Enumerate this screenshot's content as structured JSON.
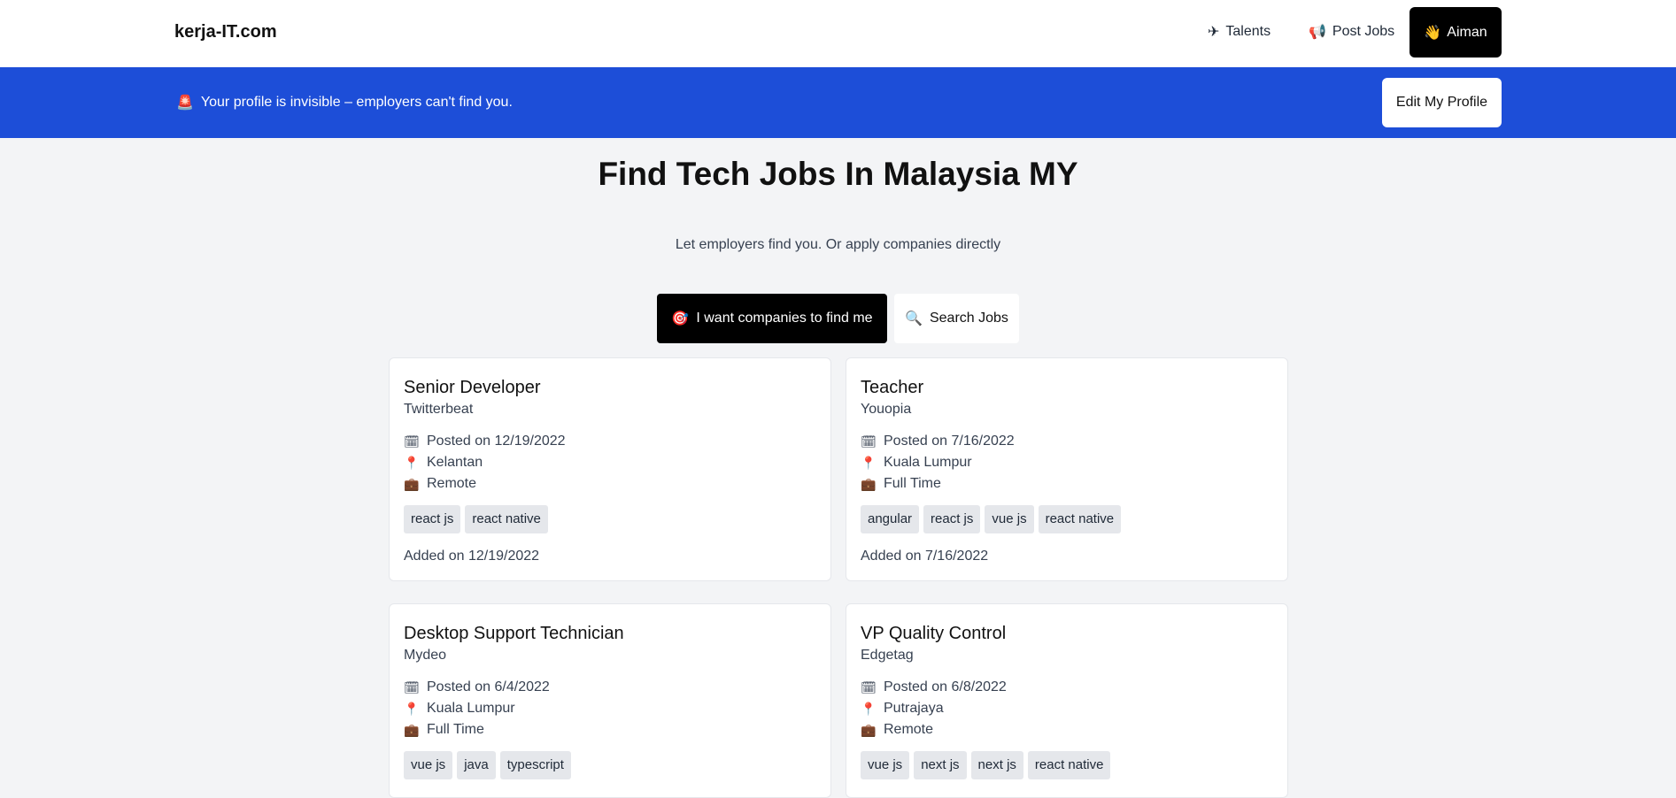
{
  "navbar": {
    "brand": "kerja-IT.com",
    "links": [
      {
        "icon": "✈",
        "label": "Talents"
      },
      {
        "icon": "📢",
        "label": "Post Jobs"
      }
    ],
    "user": {
      "icon": "👋",
      "label": "Aiman"
    }
  },
  "banner": {
    "icon": "🚨",
    "text": "Your profile is invisible – employers can't find you.",
    "button": "Edit My Profile"
  },
  "hero": {
    "title": "Find Tech Jobs In Malaysia MY",
    "subtitle": "Let employers find you. Or apply companies directly"
  },
  "toggle": {
    "primary": {
      "icon": "🎯",
      "label": "I want companies to find me"
    },
    "secondary": {
      "icon": "🔍",
      "label": "Search Jobs"
    }
  },
  "jobs": [
    {
      "title": "Senior Developer",
      "company": "Twitterbeat",
      "posted": "Posted on 12/19/2022",
      "location": "Kelantan",
      "type": "Remote",
      "tags": [
        "react js",
        "react native"
      ],
      "added": "Added on 12/19/2022"
    },
    {
      "title": "Teacher",
      "company": "Youopia",
      "posted": "Posted on 7/16/2022",
      "location": "Kuala Lumpur",
      "type": "Full Time",
      "tags": [
        "angular",
        "react js",
        "vue js",
        "react native"
      ],
      "added": "Added on 7/16/2022"
    },
    {
      "title": "Desktop Support Technician",
      "company": "Mydeo",
      "posted": "Posted on 6/4/2022",
      "location": "Kuala Lumpur",
      "type": "Full Time",
      "tags": [
        "vue js",
        "java",
        "typescript"
      ],
      "added": ""
    },
    {
      "title": "VP Quality Control",
      "company": "Edgetag",
      "posted": "Posted on 6/8/2022",
      "location": "Putrajaya",
      "type": "Remote",
      "tags": [
        "vue js",
        "next js",
        "next js",
        "react native"
      ],
      "added": ""
    }
  ],
  "icons": {
    "calendar": "calendar-icon",
    "location": "pin-icon",
    "jobtype": "briefcase-icon"
  }
}
